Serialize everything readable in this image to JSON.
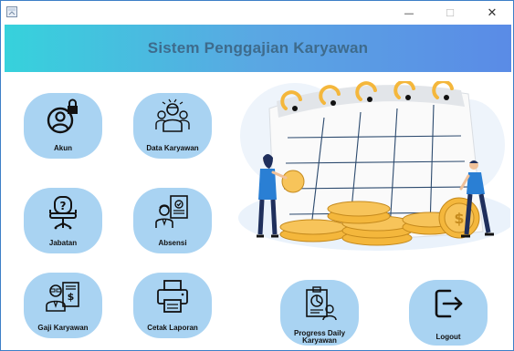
{
  "window": {
    "minimize_glyph": "—",
    "maximize_glyph": "☐",
    "close_glyph": "✕"
  },
  "header": {
    "title": "Sistem Penggajian Karyawan"
  },
  "menu": {
    "akun": "Akun",
    "data_karyawan": "Data Karyawan",
    "jabatan": "Jabatan",
    "absensi": "Absensi",
    "gaji_karyawan": "Gaji Karyawan",
    "cetak_laporan": "Cetak Laporan",
    "progress_line1": "Progress Daily",
    "progress_line2": "Karyawan",
    "logout": "Logout"
  },
  "colors": {
    "banner_start": "#36d2dc",
    "banner_end": "#5a8be6",
    "banner_text": "#3e6b8c",
    "tile_bg": "#a9d3f2",
    "coin": "#f4b73c"
  },
  "icons": [
    "user-lock-icon",
    "team-icon",
    "chair-question-icon",
    "attendance-icon",
    "payroll-icon",
    "printer-icon",
    "report-chart-icon",
    "logout-icon",
    "calendar-illustration"
  ]
}
